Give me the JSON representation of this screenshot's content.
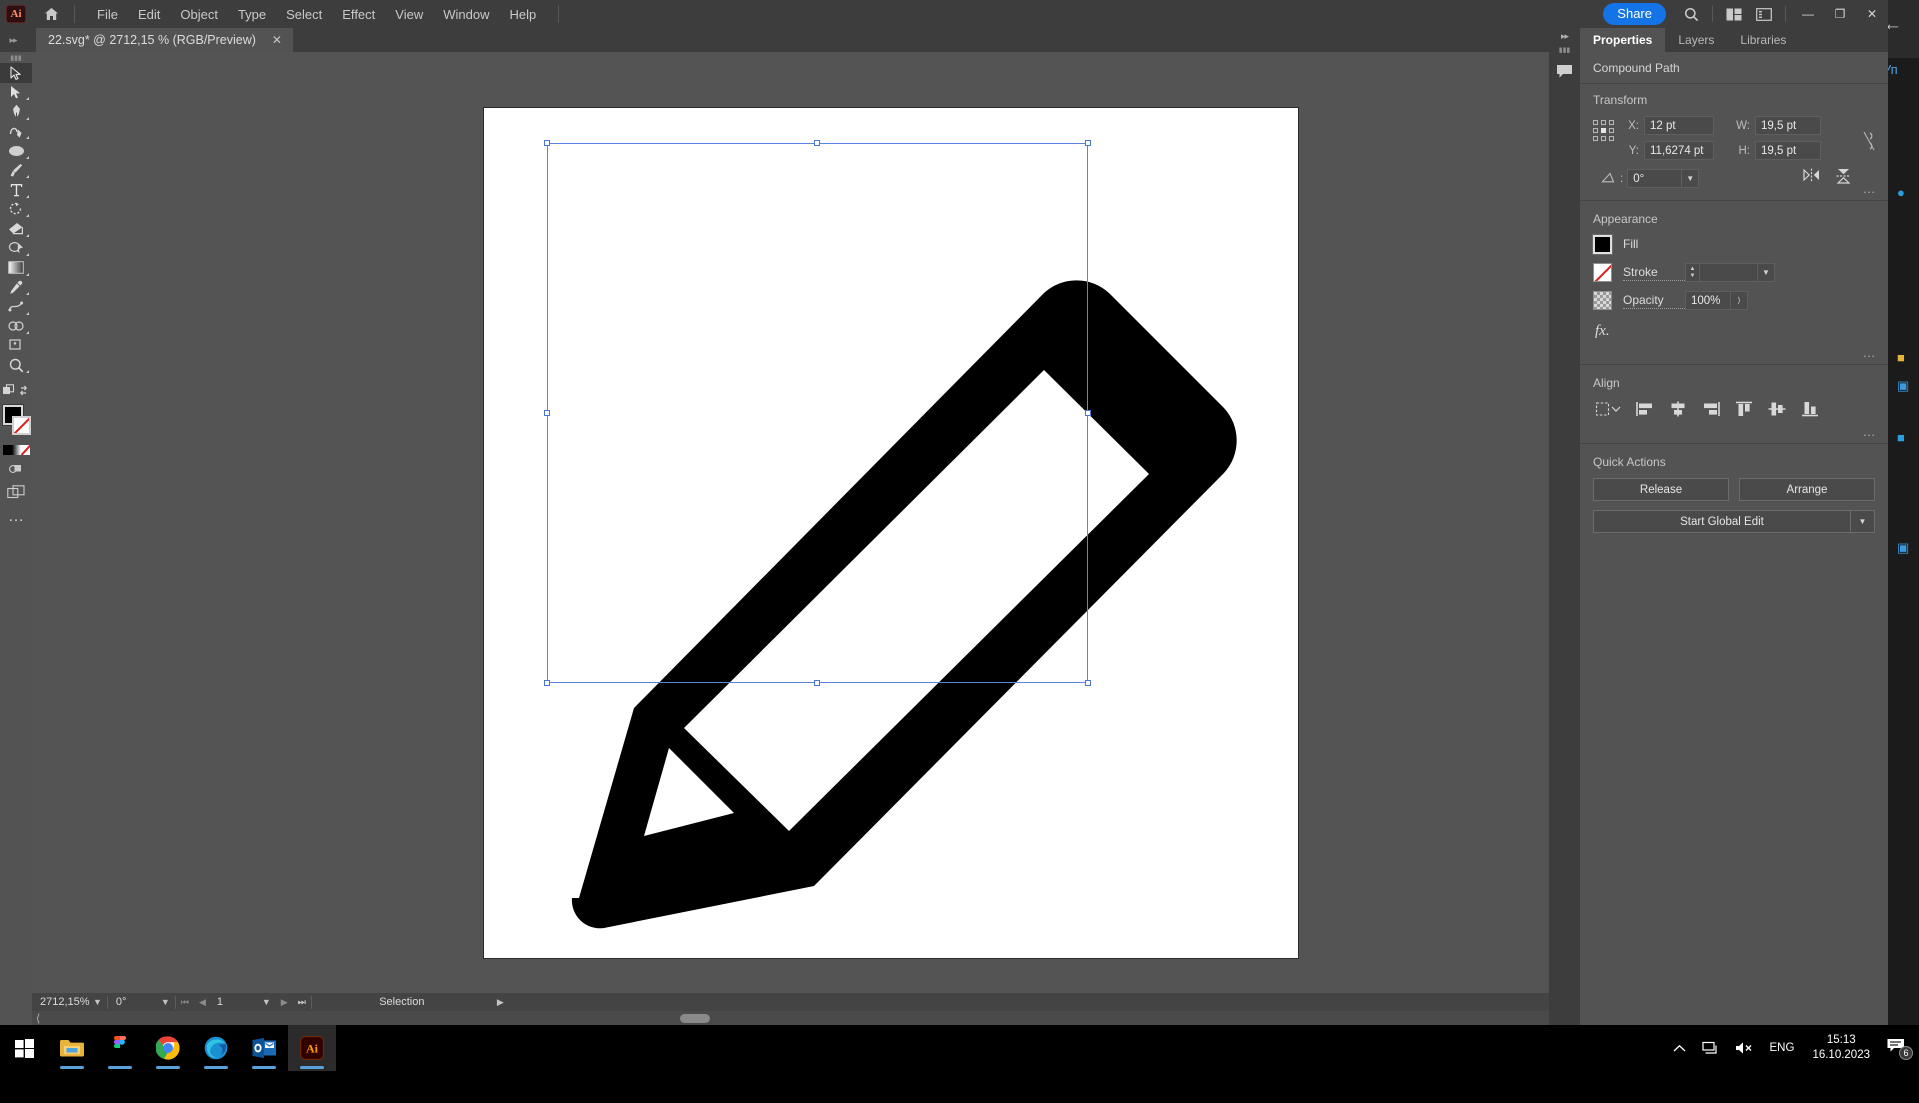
{
  "app": {
    "logo": "Ai",
    "home_icon": "home-icon"
  },
  "menubar": {
    "items": [
      {
        "label": "File"
      },
      {
        "label": "Edit"
      },
      {
        "label": "Object"
      },
      {
        "label": "Type"
      },
      {
        "label": "Select"
      },
      {
        "label": "Effect"
      },
      {
        "label": "View"
      },
      {
        "label": "Window"
      },
      {
        "label": "Help"
      }
    ],
    "share_label": "Share",
    "search_icon": "search-icon",
    "arrange_docs_icon": "arrange-documents-icon",
    "workspace_icon": "workspace-switcher-icon",
    "minimize": "—",
    "maximize": "❐",
    "close": "✕"
  },
  "tabs": {
    "document": {
      "title": "22.svg* @ 2712,15 % (RGB/Preview)",
      "close": "✕"
    }
  },
  "toolbar": {
    "tools": [
      {
        "name": "selection-tool",
        "active": true
      },
      {
        "name": "direct-selection-tool",
        "active": false
      },
      {
        "name": "pen-tool",
        "active": false
      },
      {
        "name": "curvature-tool",
        "active": false
      },
      {
        "name": "ellipse-tool",
        "active": false
      },
      {
        "name": "paintbrush-tool",
        "active": false
      },
      {
        "name": "type-tool",
        "active": false
      },
      {
        "name": "rotate-tool",
        "active": false
      },
      {
        "name": "eraser-tool",
        "active": false
      },
      {
        "name": "free-transform-tool",
        "active": false
      },
      {
        "name": "gradient-tool",
        "active": false
      },
      {
        "name": "eyedropper-tool",
        "active": false
      },
      {
        "name": "blend-tool",
        "active": false
      },
      {
        "name": "shape-builder-tool",
        "active": false
      },
      {
        "name": "artboard-tool",
        "active": false
      },
      {
        "name": "zoom-tool",
        "active": false
      }
    ],
    "fill_color": "#000000",
    "stroke_color": "none",
    "more_tools": "…"
  },
  "canvas": {
    "artboard_background": "#ffffff",
    "artwork_name": "pencil-edit-icon",
    "artwork_fill": "#000000",
    "selection_color": "#5a84e0"
  },
  "statusbar": {
    "zoom": "2712,15%",
    "rotation": "0°",
    "artboard_number": "1",
    "tool_status": "Selection",
    "nav_first": "⏮",
    "nav_prev": "◀",
    "nav_next": "▶",
    "nav_last": "⏭"
  },
  "dock": {
    "collapse_icon": "collapse-panel-icon",
    "comment_icon": "comment-icon"
  },
  "properties": {
    "tabs": [
      {
        "label": "Properties",
        "active": true
      },
      {
        "label": "Layers",
        "active": false
      },
      {
        "label": "Libraries",
        "active": false
      }
    ],
    "object_type": "Compound Path",
    "transform": {
      "title": "Transform",
      "x_label": "X:",
      "x_value": "12 pt",
      "y_label": "Y:",
      "y_value": "11,6274 pt",
      "w_label": "W:",
      "w_value": "19,5 pt",
      "h_label": "H:",
      "h_value": "19,5 pt",
      "shear_value": "0°",
      "reference_point": "center",
      "link_icon": "link-proportions-icon",
      "flip_h_icon": "flip-horizontal-icon",
      "flip_v_icon": "flip-vertical-icon",
      "more": "…"
    },
    "appearance": {
      "title": "Appearance",
      "fill_label": "Fill",
      "fill_color": "#000000",
      "stroke_label": "Stroke",
      "stroke_color": "none",
      "stroke_weight": "",
      "opacity_label": "Opacity",
      "opacity_value": "100%",
      "fx_label": "fx.",
      "more": "…"
    },
    "align": {
      "title": "Align",
      "align_to_icon": "align-to-selection-icon",
      "buttons": [
        {
          "name": "align-left-icon"
        },
        {
          "name": "align-horizontal-center-icon"
        },
        {
          "name": "align-right-icon"
        },
        {
          "name": "align-top-icon"
        },
        {
          "name": "align-vertical-center-icon"
        },
        {
          "name": "align-bottom-icon"
        }
      ],
      "more": "…"
    },
    "quick_actions": {
      "title": "Quick Actions",
      "release_label": "Release",
      "arrange_label": "Arrange",
      "global_edit_label": "Start Global Edit"
    }
  },
  "background_window": {
    "back_icon": "back-arrow-icon",
    "header": "Уп"
  },
  "taskbar": {
    "items": [
      {
        "name": "start-button",
        "running": false
      },
      {
        "name": "file-explorer",
        "running": true
      },
      {
        "name": "figma",
        "running": true
      },
      {
        "name": "google-chrome",
        "running": true
      },
      {
        "name": "microsoft-edge",
        "running": true
      },
      {
        "name": "outlook",
        "running": true
      },
      {
        "name": "adobe-illustrator",
        "running": true,
        "active": true
      }
    ],
    "tray": {
      "show_hidden_icon": "chevron-up-icon",
      "network_icon": "network-icon",
      "volume_icon": "volume-muted-icon",
      "language": "ENG",
      "time": "15:13",
      "date": "16.10.2023",
      "notification_count": "6"
    }
  }
}
